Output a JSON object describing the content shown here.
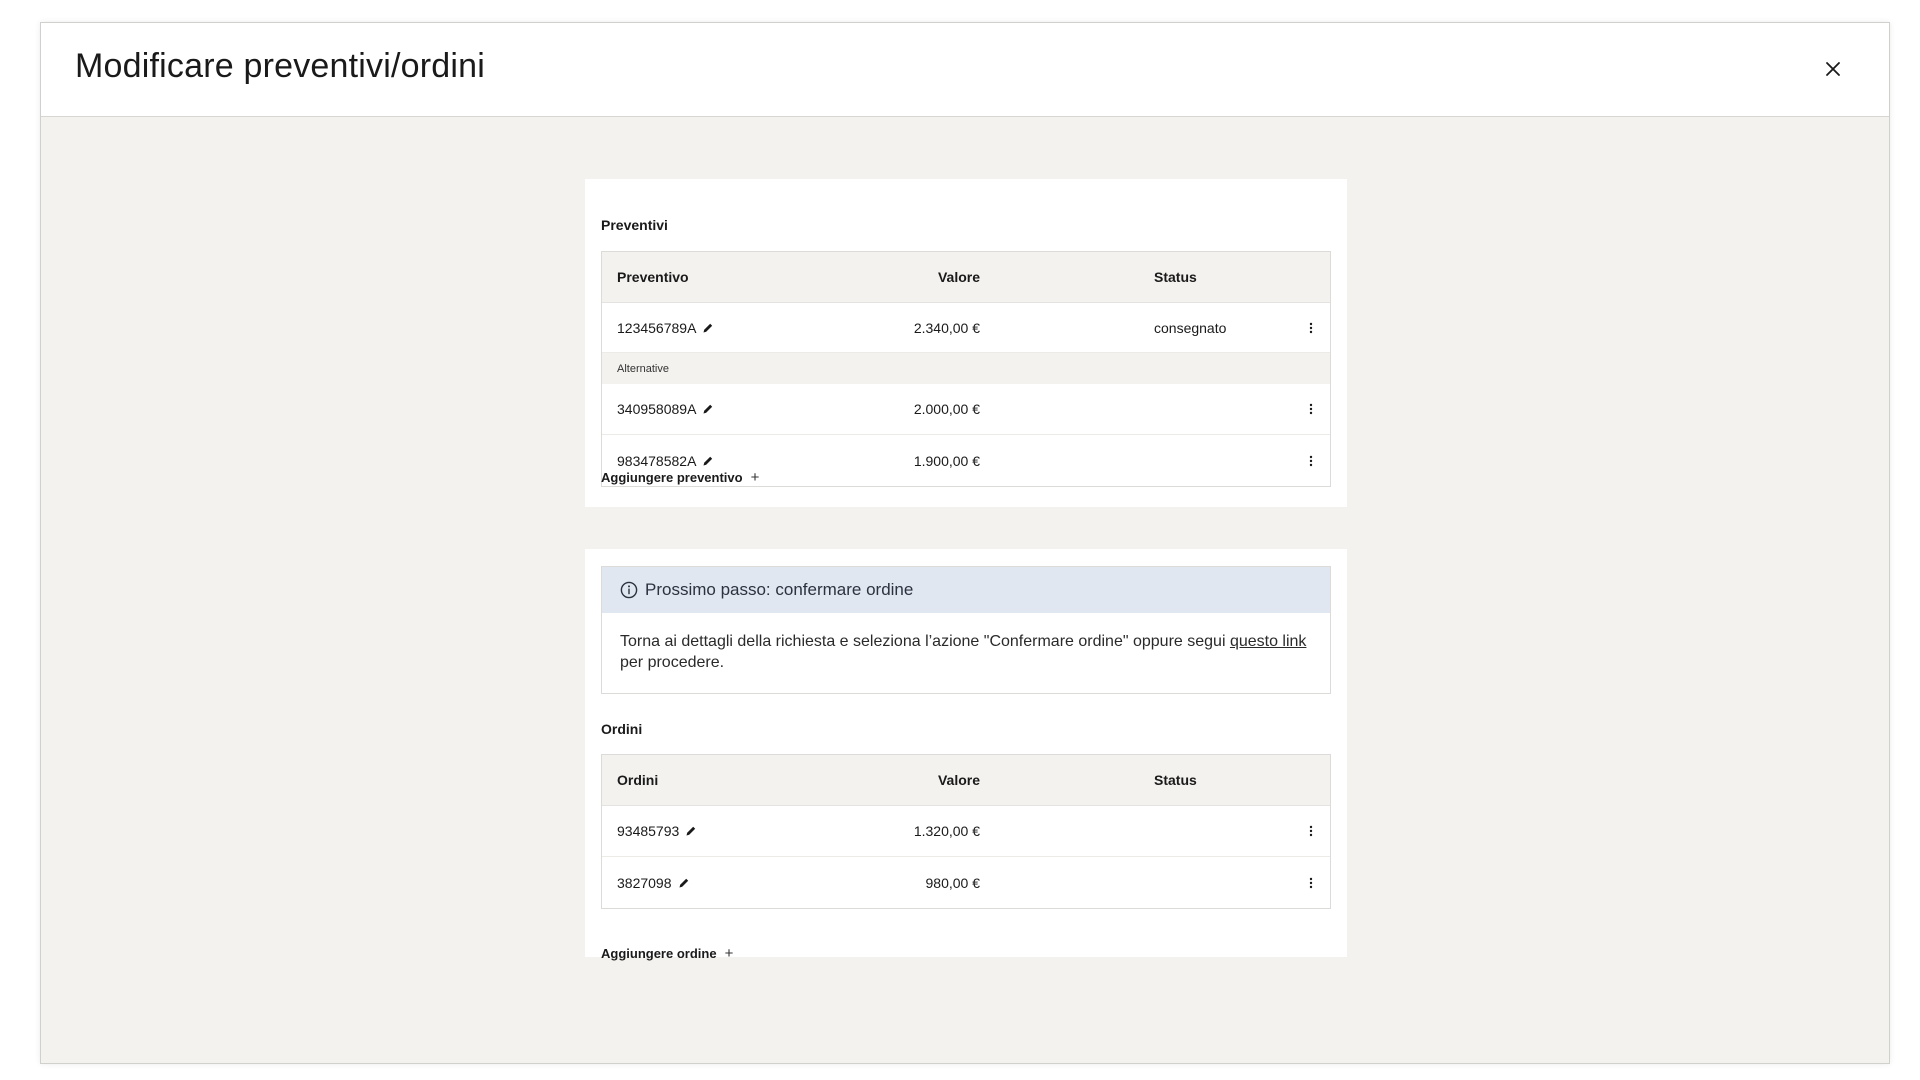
{
  "modal": {
    "title": "Modificare preventivi/ordini",
    "close_icon": "close-icon"
  },
  "quotes": {
    "section_title": "Preventivi",
    "headers": {
      "id": "Preventivo",
      "value": "Valore",
      "status": "Status"
    },
    "main_row": {
      "id": "123456789A",
      "value": "2.340,00 €",
      "status": "consegnato"
    },
    "alternatives_label": "Alternative",
    "alternatives": [
      {
        "id": "340958089A",
        "value": "2.000,00 €",
        "status": ""
      },
      {
        "id": "983478582A",
        "value": "1.900,00 €",
        "status": ""
      }
    ],
    "add_label": "Aggiungere preventivo",
    "add_icon": "plus-icon"
  },
  "notice": {
    "title": "Prossimo passo: confermare ordine",
    "text_before": "Torna ai dettagli della richiesta e seleziona l’azione \"Confermare ordine\" oppure segui ",
    "link_text": "questo link",
    "text_after": " per procedere.",
    "icon": "info-icon",
    "bg_color": "#e1e7f0"
  },
  "orders": {
    "section_title": "Ordini",
    "headers": {
      "id": "Ordini",
      "value": "Valore",
      "status": "Status"
    },
    "rows": [
      {
        "id": "93485793",
        "value": "1.320,00 €",
        "status": ""
      },
      {
        "id": "3827098",
        "value": "980,00 €",
        "status": ""
      }
    ],
    "add_label": "Aggiungere ordine",
    "add_icon": "plus-icon"
  },
  "colors": {
    "page_bg": "#f3f2ef",
    "card_bg": "#ffffff",
    "table_header_bg": "#f3f2ef"
  }
}
